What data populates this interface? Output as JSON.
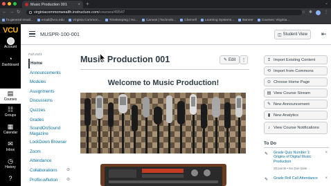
{
  "browser": {
    "tab_title": "Music Production 001",
    "url_host": "virginiacommonwealth.instructure.com",
    "url_path": "/courses/49547",
    "bookmarks": [
      "l'a general email...",
      "email@vcu.edu",
      "Virginia Common...",
      "Timekeeping | Ho...",
      "Canvas | Technolo...",
      "Chervell",
      "Learning Systems...",
      "Banner",
      "Courses: Virginia..."
    ]
  },
  "global_nav": {
    "logo": "VCU",
    "items": [
      {
        "icon": "☺",
        "label": "Account"
      },
      {
        "icon": "◔",
        "label": "Dashboard"
      },
      {
        "icon": "▤",
        "label": "Courses"
      },
      {
        "icon": "☷",
        "label": "Groups"
      },
      {
        "icon": "▦",
        "label": "Calendar"
      },
      {
        "icon": "✉",
        "label": "Inbox"
      },
      {
        "icon": "◷",
        "label": "History"
      },
      {
        "icon": "?",
        "label": "Help"
      }
    ]
  },
  "header": {
    "breadcrumb": "MUSPR-100-001",
    "student_view": "Student View"
  },
  "course_nav": {
    "term": "Fall 2021",
    "items": [
      {
        "label": "Home"
      },
      {
        "label": "Announcements"
      },
      {
        "label": "Modules"
      },
      {
        "label": "Assignments"
      },
      {
        "label": "Discussions"
      },
      {
        "label": "Quizzes"
      },
      {
        "label": "Grades"
      },
      {
        "label": "SoundOnSound Magazine"
      },
      {
        "label": "LockDown Browser"
      },
      {
        "label": "Zoom"
      },
      {
        "label": "Attendance"
      },
      {
        "label": "Collaborations"
      },
      {
        "label": "Proflix-wflution"
      }
    ]
  },
  "main": {
    "page_title": "Music Production 001",
    "edit_label": "Edit",
    "more_label": "⋮",
    "welcome_heading": "Welcome to Music Production!"
  },
  "sidebar": {
    "buttons": [
      {
        "icon": "↥",
        "label": "Import Existing Content"
      },
      {
        "icon": "⟲",
        "label": "Import from Commons"
      },
      {
        "icon": "⊙",
        "label": "Choose Home Page"
      },
      {
        "icon": "▤",
        "label": "View Course Stream"
      },
      {
        "icon": "✎",
        "label": "New Announcement"
      },
      {
        "icon": "▮",
        "label": "New Analytics"
      },
      {
        "icon": "♪",
        "label": "View Course Notifications"
      }
    ],
    "todo_title": "To Do",
    "todo_items": [
      {
        "title": "Grade Quiz Number 1: Origins of Digital Music Production",
        "meta": "20 points • No Due Date"
      },
      {
        "title": "Grade Roll Call Attendance",
        "meta": ""
      }
    ]
  },
  "colors": {
    "global_nav_bg": "#000000",
    "logo_gold": "#f8b300",
    "link_blue": "#0770a3",
    "text_dark": "#2d3b45"
  }
}
